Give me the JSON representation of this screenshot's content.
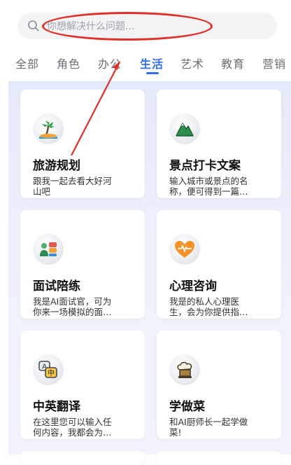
{
  "search": {
    "placeholder": "你想解决什么问题..."
  },
  "tabs": [
    {
      "label": "全部"
    },
    {
      "label": "角色"
    },
    {
      "label": "办公"
    },
    {
      "label": "生活"
    },
    {
      "label": "艺术"
    },
    {
      "label": "教育"
    },
    {
      "label": "营销"
    }
  ],
  "active_tab": "生活",
  "cards": [
    {
      "title": "旅游规划",
      "desc": "跟我一起去看大好河\n山吧",
      "icon": "palm-island-icon"
    },
    {
      "title": "景点打卡文案",
      "desc": "输入城市或景点的名\n称，便可得到一篇…",
      "icon": "mountain-icon"
    },
    {
      "title": "面试陪练",
      "desc": "我是AI面试官，可为\n你来一场模拟的面…",
      "icon": "interview-people-icon"
    },
    {
      "title": "心理咨询",
      "desc": "我是的私人心理医\n生，会为你提供指…",
      "icon": "heart-pulse-icon"
    },
    {
      "title": "中英翻译",
      "desc": "在这里您可以输入任\n何内容，我都会为…",
      "icon": "translate-icon",
      "icon_text": {
        "a": "A",
        "zh": "中"
      }
    },
    {
      "title": "学做菜",
      "desc": "和AI厨师长一起学做\n菜!",
      "icon": "chef-hat-icon"
    }
  ],
  "colors": {
    "accent": "#2f6df6",
    "annotation": "#e0302a"
  }
}
